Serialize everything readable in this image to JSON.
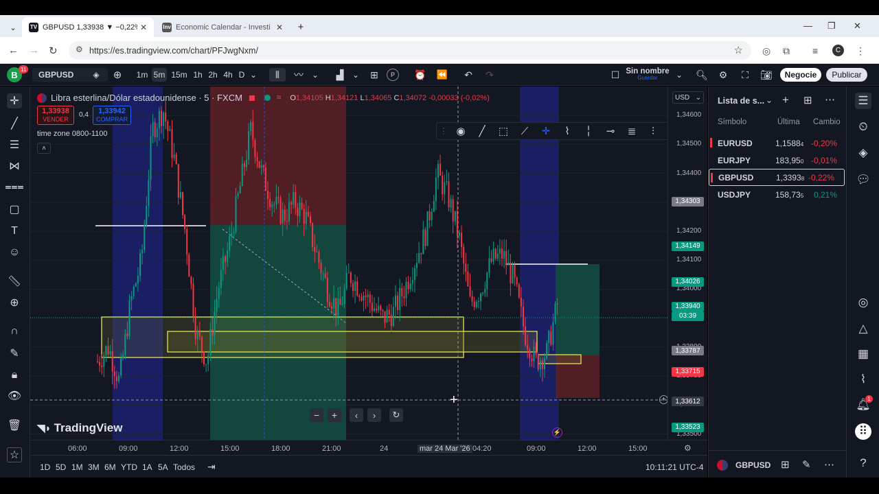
{
  "browser": {
    "tabs": [
      {
        "icon": "tradingview-favicon",
        "title": "GBPUSD 1,33938 ▼ −0,22% Sin",
        "active": true
      },
      {
        "icon": "investing-favicon",
        "title": "Economic Calendar - Investing.",
        "active": false
      }
    ],
    "new_tab": "+",
    "url": "https://es.tradingview.com/chart/PFJwgNxm/",
    "profile_initial": "C"
  },
  "toolbar": {
    "avatar_letter": "B",
    "avatar_badge": "11",
    "symbol": "GBPUSD",
    "intervals": [
      "1m",
      "5m",
      "15m",
      "1h",
      "2h",
      "4h",
      "D"
    ],
    "selected_interval": "5m",
    "layout_name": "Sin nombre",
    "layout_sub": "Guardar",
    "trade_button": "Negocie",
    "publish_button": "Publicar"
  },
  "legend": {
    "title": "Libra esterlina/Dólar estadounidense · 5 · FXCM",
    "open_label": "O",
    "open": "1,34105",
    "high_label": "H",
    "high": "1,34121",
    "low_label": "L",
    "low": "1,34065",
    "close_label": "C",
    "close": "1,34072",
    "change": "-0,00033 (-0,02%)",
    "sell_price": "1,33938",
    "sell_label": "VENDER",
    "spread": "0,4",
    "buy_price": "1,33942",
    "buy_label": "COMPRAR",
    "indicator": "time zone 0800-1100",
    "currency": "USD",
    "watermark": "TradingView"
  },
  "chart_data": {
    "type": "candlestick",
    "symbol": "GBPUSD",
    "interval": "5",
    "ylim": [
      1.3348,
      1.347
    ],
    "x_ticks": [
      "06:00",
      "09:00",
      "12:00",
      "15:00",
      "18:00",
      "21:00",
      "24",
      "mar 24 Mar '26",
      "04:20",
      "09:00",
      "12:00",
      "15:00"
    ],
    "y_ticks": [
      "1,34600",
      "1,34500",
      "1,34400",
      "1,34300",
      "1,34200",
      "1,34100",
      "1,34000",
      "1,33900",
      "1,33800",
      "1,33700",
      "1,33600",
      "1,33500"
    ],
    "price_labels": [
      {
        "value": "1,34303",
        "color": "#787b86"
      },
      {
        "value": "1,34149",
        "color": "#089981"
      },
      {
        "value": "1,34026",
        "color": "#089981"
      },
      {
        "value": "1,33940",
        "color": "#089981",
        "sub": "03:39"
      },
      {
        "value": "1,33787",
        "color": "#787b86"
      },
      {
        "value": "1,33715",
        "color": "#f23645"
      },
      {
        "value": "1,33612",
        "color": "#363a45"
      },
      {
        "value": "1,33523",
        "color": "#089981"
      }
    ],
    "close_path": [
      1.3375,
      1.338,
      1.3368,
      1.3395,
      1.341,
      1.3455,
      1.3462,
      1.3445,
      1.342,
      1.3385,
      1.3375,
      1.34,
      1.3415,
      1.3435,
      1.3455,
      1.344,
      1.343,
      1.3425,
      1.343,
      1.3425,
      1.3412,
      1.34,
      1.3392,
      1.3405,
      1.34,
      1.3395,
      1.339,
      1.3392,
      1.34,
      1.341,
      1.342,
      1.344,
      1.3432,
      1.3418,
      1.3395,
      1.34,
      1.341,
      1.3412,
      1.3403,
      1.3385,
      1.3375,
      1.3378,
      1.3395
    ]
  },
  "time_axis": [
    "06:00",
    "09:00",
    "12:00",
    "15:00",
    "18:00",
    "21:00",
    "24",
    "mar 24 Mar '26",
    "04:20",
    "09:00",
    "12:00",
    "15:00"
  ],
  "bottom": {
    "ranges": [
      "1D",
      "5D",
      "1M",
      "3M",
      "6M",
      "YTD",
      "1A",
      "5A",
      "Todos"
    ],
    "clock": "10:11:21 UTC-4"
  },
  "watchlist": {
    "title": "Lista de s...",
    "columns": [
      "Símbolo",
      "Última",
      "Cambio"
    ],
    "rows": [
      {
        "symbol": "EURUSD",
        "last": "1,1588",
        "last_sup": "4",
        "change": "-0,20%",
        "dir": "down",
        "flag": "#f23645"
      },
      {
        "symbol": "EURJPY",
        "last": "183,95",
        "last_sup": "0",
        "change": "-0,01%",
        "dir": "down",
        "flag": ""
      },
      {
        "symbol": "GBPUSD",
        "last": "1,3393",
        "last_sup": "8",
        "change": "-0,22%",
        "dir": "down",
        "flag": "#f23645"
      },
      {
        "symbol": "USDJPY",
        "last": "158,73",
        "last_sup": "5",
        "change": "0,21%",
        "dir": "up",
        "flag": ""
      }
    ],
    "footer_symbol": "GBPUSD"
  },
  "colors": {
    "up": "#089981",
    "down": "#f23645",
    "accent": "#2962ff",
    "bg": "#131722"
  }
}
